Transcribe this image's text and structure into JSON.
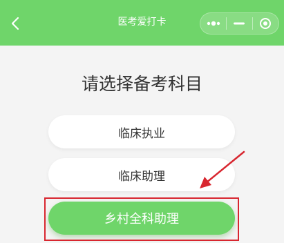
{
  "header": {
    "title": "医考爱打卡",
    "back_icon": "chevron-left-icon",
    "capsule": {
      "menu_icon": "more-dots-icon",
      "minimize_icon": "minimize-icon",
      "close_icon": "target-icon"
    },
    "color": "#6fd56a"
  },
  "main": {
    "prompt": "请选择备考科目",
    "options": [
      {
        "label": "临床执业",
        "selected": false
      },
      {
        "label": "临床助理",
        "selected": false
      },
      {
        "label": "乡村全科助理",
        "selected": true
      }
    ]
  },
  "annotations": {
    "highlight_color": "#d8262f"
  }
}
